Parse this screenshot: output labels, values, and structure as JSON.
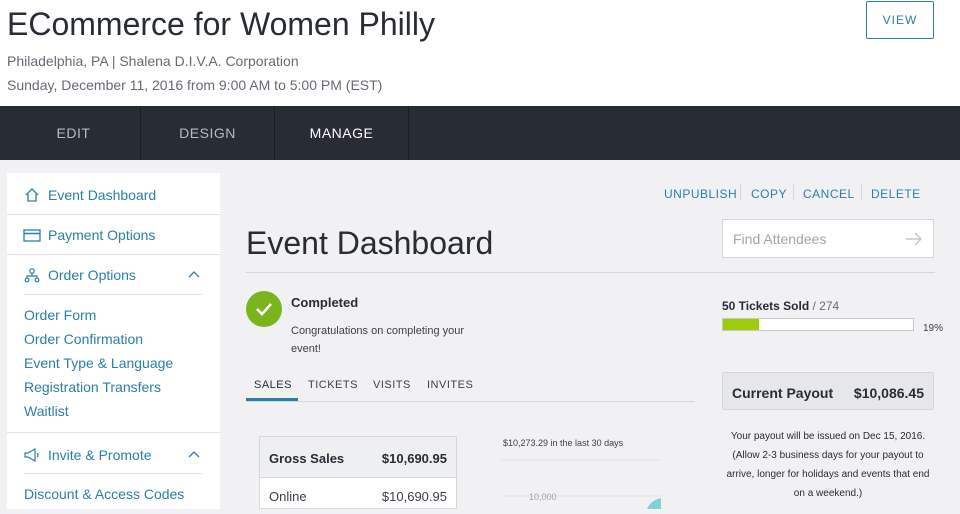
{
  "header": {
    "event_title": "ECommerce for Women Philly",
    "location_org": "Philadelphia, PA | Shalena D.I.V.A. Corporation",
    "datetime": "Sunday, December 11, 2016 from 9:00 AM to 5:00 PM (EST)",
    "view_label": "VIEW"
  },
  "tabs": [
    "EDIT",
    "DESIGN",
    "MANAGE"
  ],
  "sidebar": {
    "event_dashboard": "Event Dashboard",
    "payment_options": "Payment Options",
    "order_options": "Order Options",
    "order_links": [
      "Order Form",
      "Order Confirmation",
      "Event Type & Language",
      "Registration Transfers",
      "Waitlist"
    ],
    "invite_promote": "Invite & Promote",
    "discount_codes": "Discount & Access Codes"
  },
  "actions": [
    "UNPUBLISH",
    "COPY",
    "CANCEL",
    "DELETE"
  ],
  "main": {
    "title": "Event Dashboard",
    "search_placeholder": "Find Attendees",
    "status_title": "Completed",
    "status_message": "Congratulations on completing your event!",
    "subtabs": [
      "SALES",
      "TICKETS",
      "VISITS",
      "INVITES"
    ],
    "gross_sales_label": "Gross Sales",
    "gross_sales_value": "$10,690.95",
    "online_label": "Online",
    "online_value": "$10,690.95",
    "chart_caption": "$10,273.29 in the last 30 days",
    "chart_tick": "10,000"
  },
  "tickets": {
    "sold": "50 Tickets Sold",
    "capacity": "/ 274",
    "percent_label": "19%",
    "progress": 0.19
  },
  "payout": {
    "label": "Current Payout",
    "value": "$10,086.45",
    "note": "Your payout will be issued on Dec 15, 2016. (Allow 2-3 business days for your payout to arrive, longer for holidays and events that end on a weekend.)"
  },
  "colors": {
    "accent": "#2a7fa8",
    "nav_bg": "#282c35",
    "success": "#7ab51d",
    "progress": "#9ccc0c",
    "chart": "#7fd3d6"
  }
}
